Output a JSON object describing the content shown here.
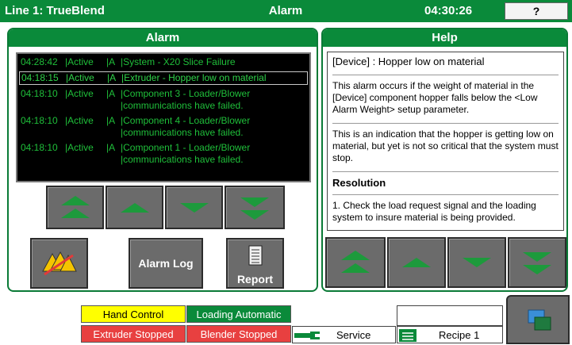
{
  "titlebar": {
    "line": "Line 1: TrueBlend",
    "center": "Alarm",
    "time": "04:30:26",
    "help_button": "?"
  },
  "alarm_panel": {
    "header": "Alarm",
    "rows": [
      {
        "time": "04:28:42",
        "state": "|Active",
        "cls": "|A",
        "msg": "|System - X20 Slice Failure",
        "selected": false
      },
      {
        "time": "04:18:15",
        "state": "|Active",
        "cls": "|A",
        "msg": "|Extruder - Hopper low on material",
        "selected": true
      },
      {
        "time": "04:18:10",
        "state": "|Active",
        "cls": "|A",
        "msg": "|Component 3 - Loader/Blower |communications have failed.",
        "selected": false
      },
      {
        "time": "04:18:10",
        "state": "|Active",
        "cls": "|A",
        "msg": "|Component 4 - Loader/Blower |communications have failed.",
        "selected": false
      },
      {
        "time": "04:18:10",
        "state": "|Active",
        "cls": "|A",
        "msg": "|Component 1 - Loader/Blower |communications have failed.",
        "selected": false
      }
    ],
    "alarm_log_label": "Alarm Log",
    "report_label": "Report"
  },
  "help_panel": {
    "header": "Help",
    "title": "[Device] : Hopper low on material",
    "para1": "This alarm occurs if the weight of material in the [Device] component hopper falls below the <Low Alarm Weight> setup parameter.",
    "para2": "This is an indication that the hopper is getting low on material, but yet is not so critical that the system must stop.",
    "resolution": "Resolution",
    "step1": "1.   Check the load request signal and the loading system to insure material is being provided."
  },
  "status": {
    "hand_control": "Hand Control",
    "loading_automatic": "Loading Automatic",
    "extruder_stopped": "Extruder Stopped",
    "blender_stopped": "Blender Stopped",
    "service": "Service",
    "recipe": "Recipe 1"
  },
  "colors": {
    "brand_green": "#0a8a3a",
    "alarm_text": "#1fbf3a",
    "warning_yellow": "#ffff00",
    "stop_red": "#e84040"
  },
  "icons": [
    "page-top-icon",
    "page-up-icon",
    "page-down-icon",
    "page-bottom-icon",
    "acknowledge-alarms-icon",
    "report-document-icon",
    "service-wrench-icon",
    "recipe-folder-icon",
    "screen-navigation-icon"
  ]
}
